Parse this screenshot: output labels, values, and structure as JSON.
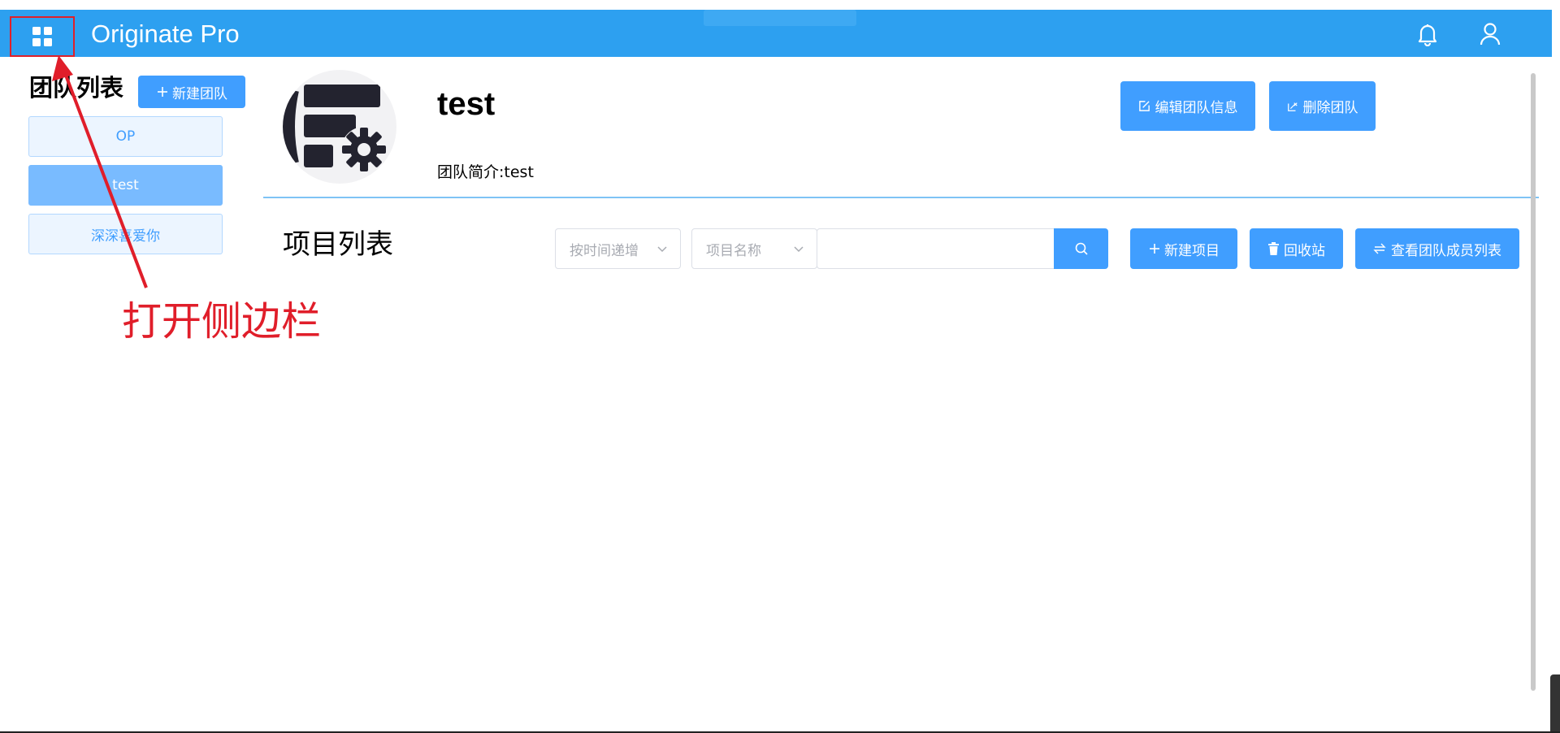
{
  "header": {
    "app_title": "Originate Pro",
    "menu_icon": "grid-icon",
    "bell_icon": "bell-icon",
    "user_icon": "user-icon",
    "background_color": "#2da0f0"
  },
  "sidebar": {
    "title": "团队列表",
    "new_team_label": "新建团队",
    "teams": [
      {
        "label": "OP",
        "active": false
      },
      {
        "label": "test",
        "active": true
      },
      {
        "label": "深深喜爱你",
        "active": false
      }
    ]
  },
  "team": {
    "name": "test",
    "description": "团队简介:test",
    "edit_label": "编辑团队信息",
    "delete_label": "删除团队"
  },
  "projects": {
    "title": "项目列表",
    "sort_placeholder": "按时间递增",
    "field_placeholder": "项目名称",
    "search_value": "",
    "new_project_label": "新建项目",
    "recycle_label": "回收站",
    "members_label": "查看团队成员列表"
  },
  "annotation": {
    "text": "打开侧边栏",
    "color": "#e01e2a"
  },
  "colors": {
    "primary": "#409eff",
    "primary_light": "#79bbff",
    "item_bg": "#ecf5ff"
  }
}
